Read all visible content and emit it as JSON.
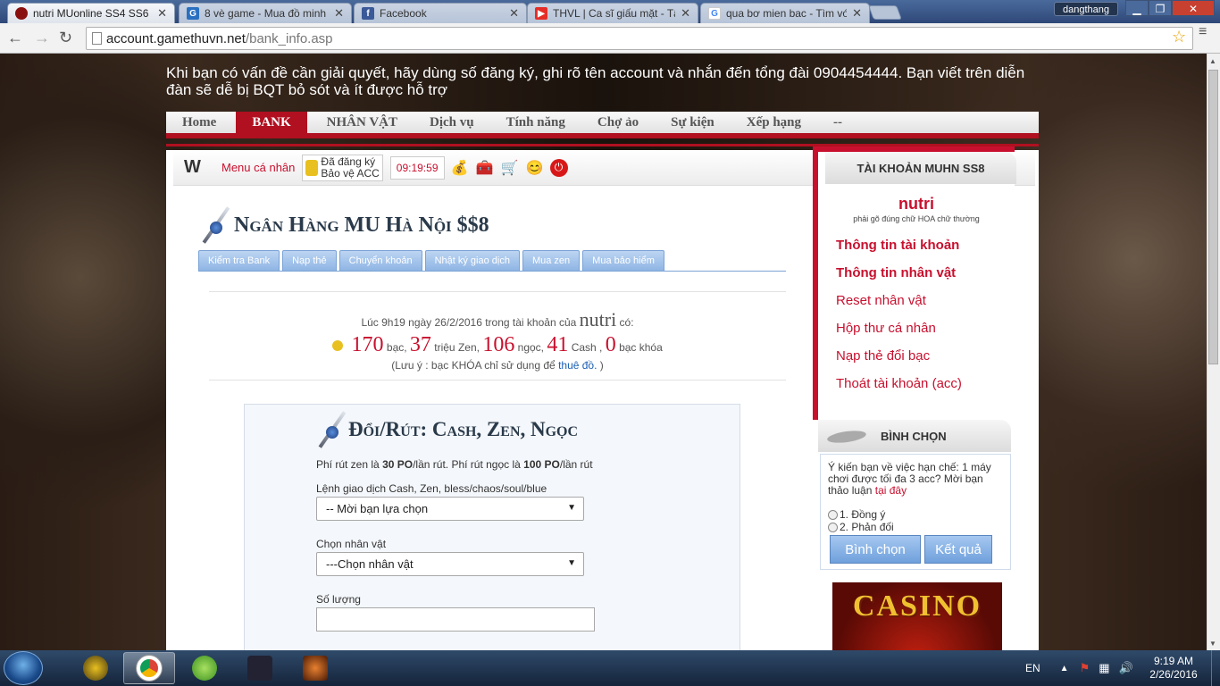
{
  "browser": {
    "tabs": [
      {
        "title": "nutri MUonline SS4 SS6 SS",
        "active": true
      },
      {
        "title": "8 vè game - Mua đồ minh",
        "active": false
      },
      {
        "title": "Facebook",
        "active": false
      },
      {
        "title": "THVL | Ca sĩ giấu mặt - Tập",
        "active": false
      },
      {
        "title": "qua bơ mien bac - Tìm với",
        "active": false
      }
    ],
    "user": "dangthang",
    "url_host": "account.gamethuvn.net",
    "url_path": "/bank_info.asp"
  },
  "page": {
    "notice": "Khi bạn có vấn đề cần giải quyết, hãy dùng số đăng ký, ghi rõ tên account và nhắn đến tổng đài 0904454444. Bạn viết trên diễn đàn sẽ dễ bị BQT bỏ sót và ít được hỗ trợ",
    "nav": [
      "Home",
      "BANK",
      "NHÂN VẬT",
      "Dịch vụ",
      "Tính năng",
      "Chợ ảo",
      "Sự kiện",
      "Xếp hạng",
      "--"
    ],
    "utilbar": {
      "logo": "W",
      "menu": "Menu cá nhân",
      "lock_line1": "Đã đăng ký",
      "lock_line2": "Bảo vệ ACC",
      "time": "09:19:59"
    },
    "bank_title": "Ngân Hàng MU Hà Nội $$8",
    "bank_tabs": [
      "Kiểm tra Bank",
      "Nạp thẻ",
      "Chuyển khoản",
      "Nhật ký giao dịch",
      "Mua zen",
      "Mua bảo hiểm"
    ],
    "info": {
      "prefix": "Lúc 9h19 ngày 26/2/2016 trong tài khoản của",
      "user": "nutri",
      "suffix": "có:",
      "bac": "170",
      "bac_unit": "bạc,",
      "zen": "37",
      "zen_unit": "triệu Zen,",
      "ngoc": "106",
      "ngoc_unit": "ngọc,",
      "cash": "41",
      "cash_unit": "Cash ,",
      "khoa": "0",
      "khoa_unit": "bạc khóa",
      "note_prefix": "(Lưu ý : bạc KHÓA chỉ sử dụng để",
      "note_link": "thuê đồ.",
      "note_suffix": ")"
    },
    "exchange": {
      "title": "Đổi/Rút: Cash, Zen, Ngọc",
      "fee_a": "Phí rút zen là",
      "fee_a_val": "30 PO",
      "fee_a_unit": "/lần rút. Phí rút ngọc là",
      "fee_b_val": "100 PO",
      "fee_b_unit": "/lần rút",
      "cmd_label": "Lệnh giao dịch Cash, Zen, bless/chaos/soul/blue",
      "cmd_value": "-- Mời bạn lựa chọn",
      "char_label": "Chọn nhân vật",
      "char_value": "---Chọn nhân vật",
      "qty_label": "Số lượng"
    }
  },
  "sidebar": {
    "account_title": "TÀI KHOẢN MUHN SS8",
    "user": "nutri",
    "hint": "phải gõ đúng chữ HOA chữ thường",
    "links": [
      "Thông tin tài khoản",
      "Thông tin nhân vật",
      "Reset nhân vật",
      "Hộp thư cá nhân",
      "Nạp thẻ đổi bạc",
      "Thoát tài khoản (acc)"
    ],
    "vote_title": "BÌNH CHỌN",
    "vote_question": "Ý kiến bạn về việc hạn chế: 1 máy chơi được tối đa 3 acc? Mời bạn thảo luận",
    "vote_link": "tại đây",
    "option1": "1. Đồng ý",
    "option2": "2. Phản đối",
    "vote_btn": "Bình chọn",
    "result_btn": "Kết quả",
    "casino": "CASINO"
  },
  "taskbar": {
    "lang": "EN",
    "time": "9:19 AM",
    "date": "2/26/2016"
  }
}
